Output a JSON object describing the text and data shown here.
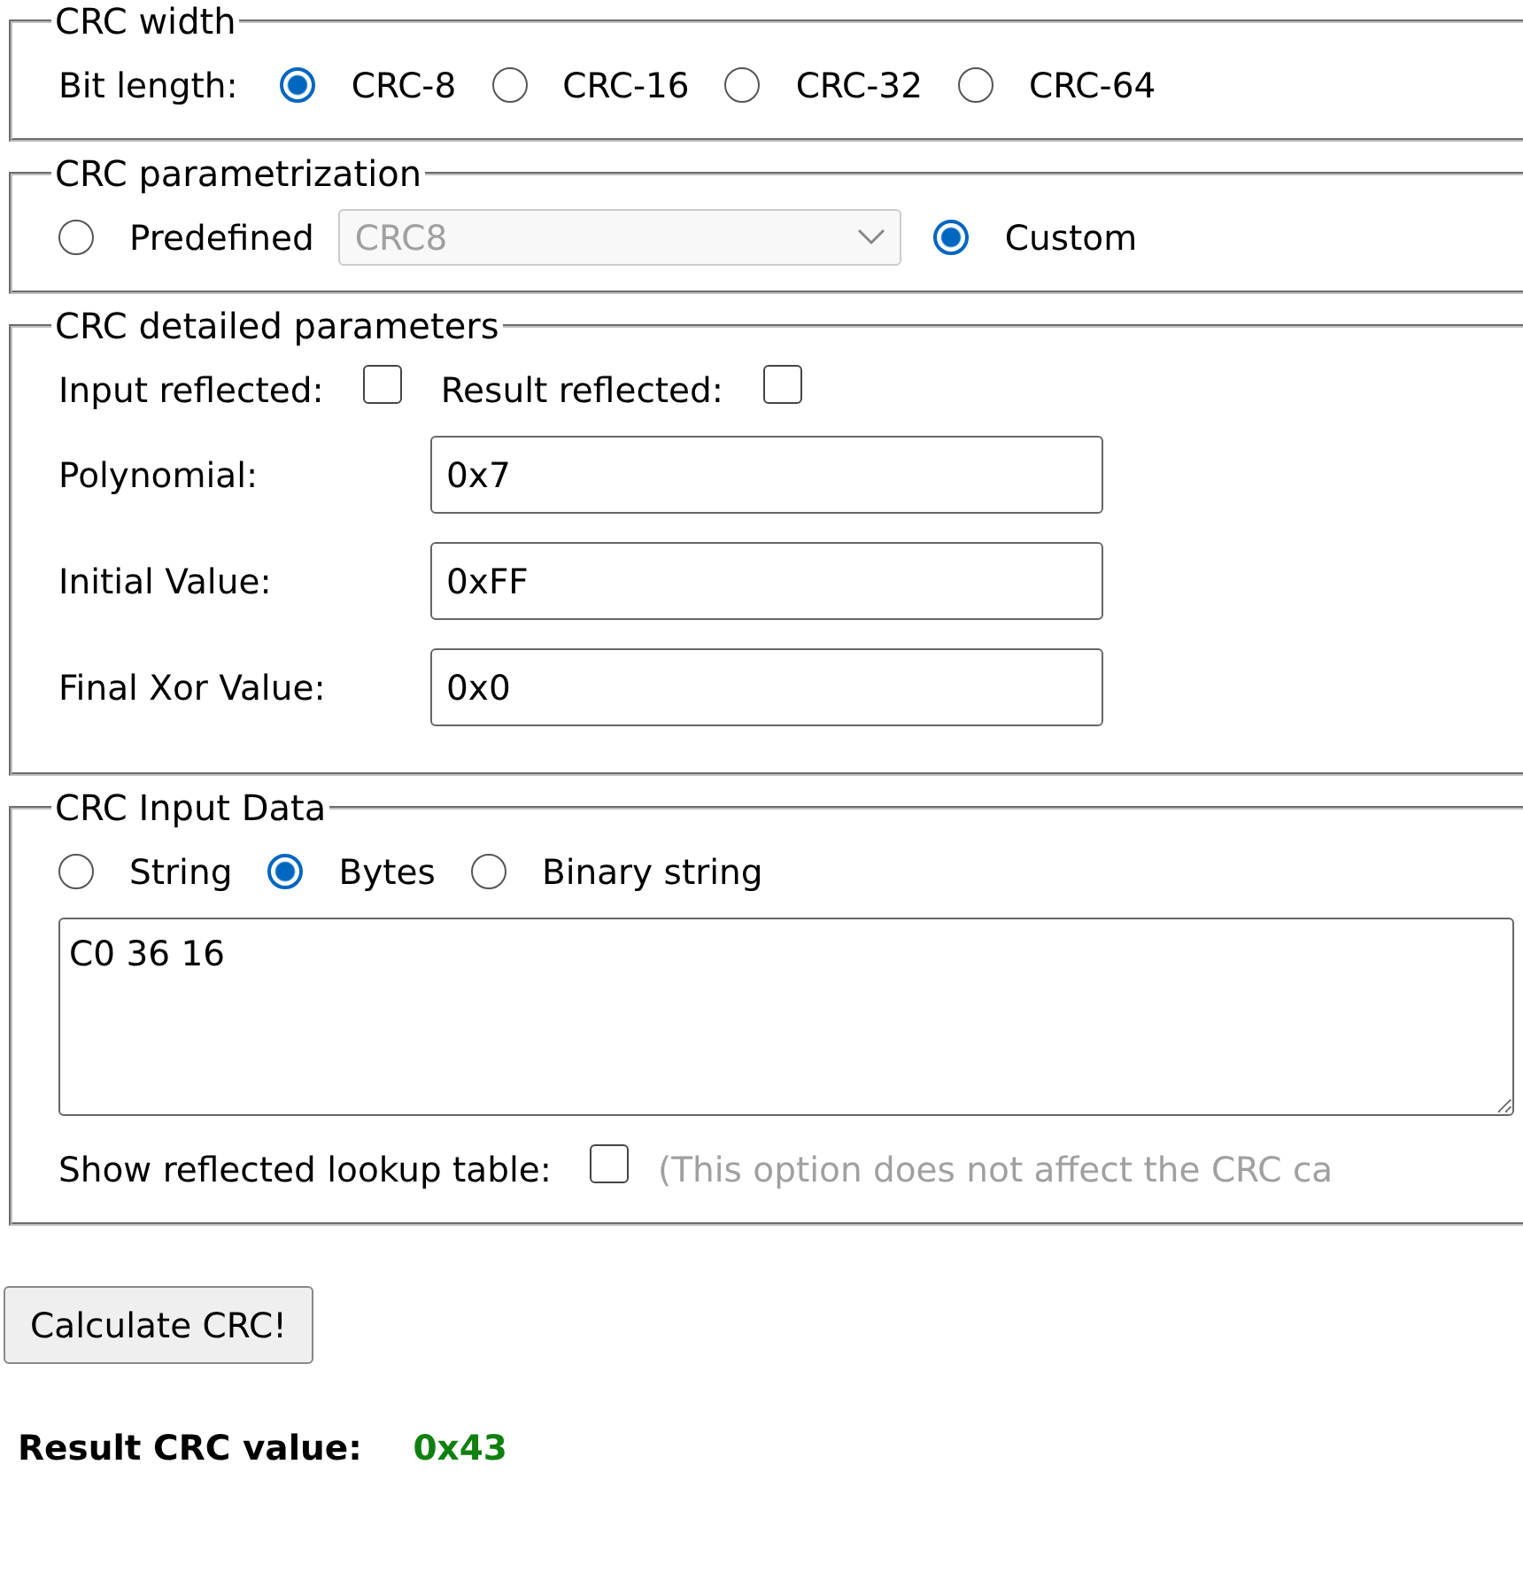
{
  "crc_width": {
    "legend": "CRC width",
    "label": "Bit length:",
    "options": [
      {
        "label": "CRC-8",
        "selected": true
      },
      {
        "label": "CRC-16",
        "selected": false
      },
      {
        "label": "CRC-32",
        "selected": false
      },
      {
        "label": "CRC-64",
        "selected": false
      }
    ]
  },
  "crc_parametrization": {
    "legend": "CRC parametrization",
    "options": [
      {
        "kind": "predefined",
        "label": "Predefined",
        "selected": false
      },
      {
        "kind": "custom",
        "label": "Custom",
        "selected": true
      }
    ],
    "predefined_select": {
      "value": "CRC8",
      "disabled": true
    }
  },
  "detailed_parameters": {
    "legend": "CRC detailed parameters",
    "checkboxes": [
      {
        "label": "Input reflected:",
        "checked": false
      },
      {
        "label": "Result reflected:",
        "checked": false
      }
    ],
    "fields": [
      {
        "label": "Polynomial:",
        "value": "0x7"
      },
      {
        "label": "Initial Value:",
        "value": "0xFF"
      },
      {
        "label": "Final Xor Value:",
        "value": "0x0"
      }
    ]
  },
  "input_data": {
    "legend": "CRC Input Data",
    "formats": [
      {
        "label": "String",
        "selected": false
      },
      {
        "label": "Bytes",
        "selected": true
      },
      {
        "label": "Binary string",
        "selected": false
      }
    ],
    "textarea": {
      "value": "C0 36 16"
    },
    "lookup_option": {
      "label": "Show reflected lookup table:",
      "checked": false,
      "note": "(This option does not affect the CRC ca"
    }
  },
  "calculate_button": "Calculate CRC!",
  "result": {
    "label": "Result CRC value:",
    "value": "0x43"
  }
}
